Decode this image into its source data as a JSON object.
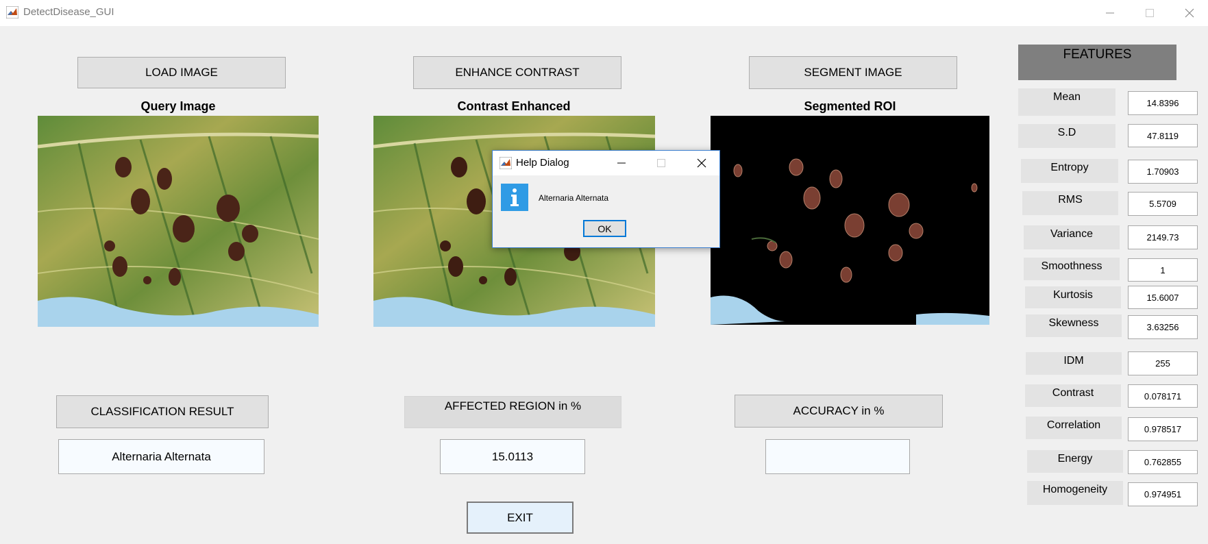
{
  "window": {
    "title": "DetectDisease_GUI",
    "minimize_icon": "minimize-icon",
    "maximize_icon": "maximize-icon",
    "close_icon": "close-icon"
  },
  "buttons": {
    "load_image": "LOAD IMAGE",
    "enhance_contrast": "ENHANCE CONTRAST",
    "segment_image": "SEGMENT IMAGE",
    "classification_result": "CLASSIFICATION RESULT",
    "affected_region": "AFFECTED REGION in %",
    "accuracy": "ACCURACY in %",
    "exit": "EXIT"
  },
  "panels": {
    "query": "Query Image",
    "contrast": "Contrast Enhanced",
    "segmented": "Segmented ROI"
  },
  "results": {
    "classification": "Alternaria Alternata",
    "affected_region": "15.0113",
    "accuracy": ""
  },
  "features": {
    "header": "FEATURES",
    "items": [
      {
        "label": "Mean",
        "value": "14.8396"
      },
      {
        "label": "S.D",
        "value": "47.8119"
      },
      {
        "label": "Entropy",
        "value": "1.70903"
      },
      {
        "label": "RMS",
        "value": "5.5709"
      },
      {
        "label": "Variance",
        "value": "2149.73"
      },
      {
        "label": "Smoothness",
        "value": "1"
      },
      {
        "label": "Kurtosis",
        "value": "15.6007"
      },
      {
        "label": "Skewness",
        "value": "3.63256"
      },
      {
        "label": "IDM",
        "value": "255"
      },
      {
        "label": "Contrast",
        "value": "0.078171"
      },
      {
        "label": "Correlation",
        "value": "0.978517"
      },
      {
        "label": "Energy",
        "value": "0.762855"
      },
      {
        "label": "Homogeneity",
        "value": "0.974951"
      }
    ]
  },
  "dialog": {
    "title": "Help Dialog",
    "message": "Alternaria Alternata",
    "ok_label": "OK",
    "icon": "info-icon"
  },
  "colors": {
    "features_header_bg": "#7f7f7f",
    "accent": "#0078d7",
    "info_icon": "#2f9be5"
  }
}
